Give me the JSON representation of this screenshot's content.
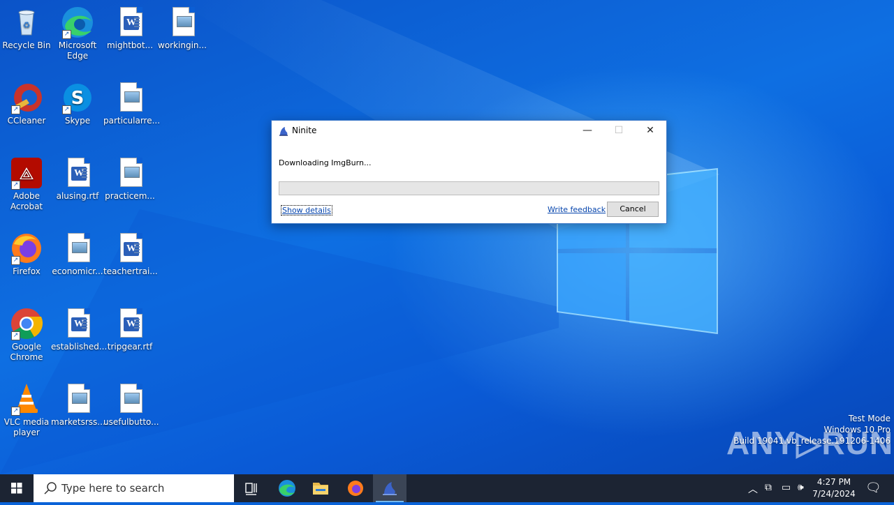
{
  "desktop": {
    "icons": [
      {
        "label": "Recycle Bin"
      },
      {
        "label": "Microsoft Edge"
      },
      {
        "label": "mightbot..."
      },
      {
        "label": "workingin..."
      },
      {
        "label": "CCleaner"
      },
      {
        "label": "Skype"
      },
      {
        "label": "particularre..."
      },
      {
        "label": "Adobe Acrobat"
      },
      {
        "label": "alusing.rtf"
      },
      {
        "label": "practicem..."
      },
      {
        "label": "Firefox"
      },
      {
        "label": "economicr..."
      },
      {
        "label": "teachertrai..."
      },
      {
        "label": "Google Chrome"
      },
      {
        "label": "established..."
      },
      {
        "label": "tripgear.rtf"
      },
      {
        "label": "VLC media player"
      },
      {
        "label": "marketsrss...."
      },
      {
        "label": "usefulbutto..."
      }
    ]
  },
  "dialog": {
    "title": "Ninite",
    "status": "Downloading ImgBurn...",
    "progress": 0,
    "show_details": "Show details",
    "write_feedback": "Write feedback",
    "cancel": "Cancel",
    "controls": {
      "minimize": "—",
      "maximize": "☐",
      "close": "✕"
    }
  },
  "watermark": {
    "brand": "ANY▷RUN",
    "line1": "Test Mode",
    "line2": "Windows 10 Pro",
    "line3": "Build 19041.vb_release.191206-1406"
  },
  "taskbar": {
    "search_placeholder": "Type here to search",
    "time": "4:27 PM",
    "date": "7/24/2024"
  },
  "colors": {
    "desktop": "#0a63d8",
    "taskbar": "#1c2433",
    "accent": "#76b9ed"
  }
}
